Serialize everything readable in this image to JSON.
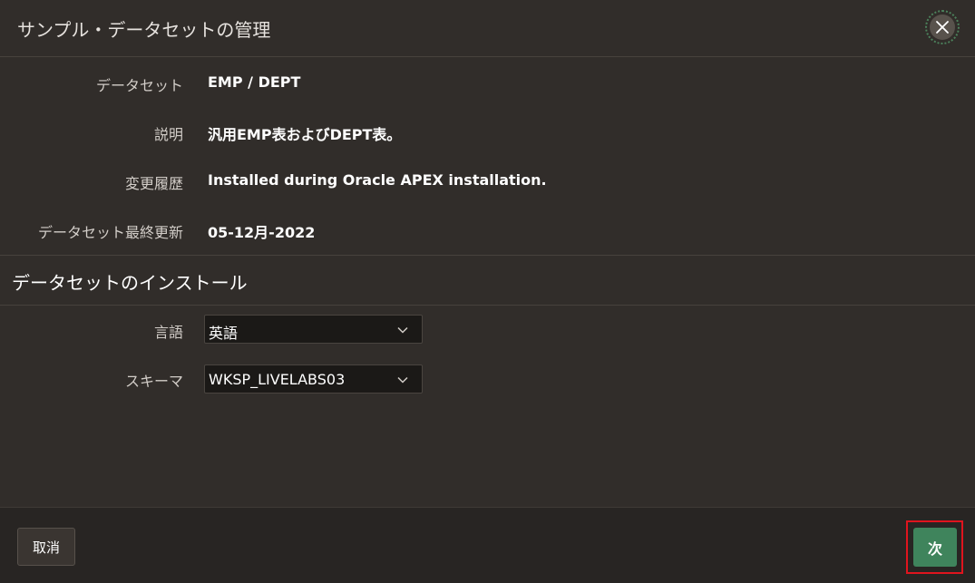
{
  "dialog": {
    "title": "サンプル・データセットの管理",
    "close_icon": "close-icon"
  },
  "details": [
    {
      "label": "データセット",
      "value": "EMP / DEPT"
    },
    {
      "label": "説明",
      "value": "汎用EMP表およびDEPT表。"
    },
    {
      "label": "変更履歴",
      "value": "Installed during Oracle APEX installation."
    },
    {
      "label": "データセット最終更新",
      "value": "05-12月-2022"
    }
  ],
  "install_section": {
    "title": "データセットのインストール",
    "language": {
      "label": "言語",
      "selected": "英語"
    },
    "schema": {
      "label": "スキーマ",
      "selected": "WKSP_LIVELABS03"
    }
  },
  "footer": {
    "cancel_label": "取消",
    "next_label": "次"
  },
  "colors": {
    "background": "#312d2a",
    "footer": "#282523",
    "primary_button": "#3f845c",
    "highlight_outline": "#e0141e"
  }
}
